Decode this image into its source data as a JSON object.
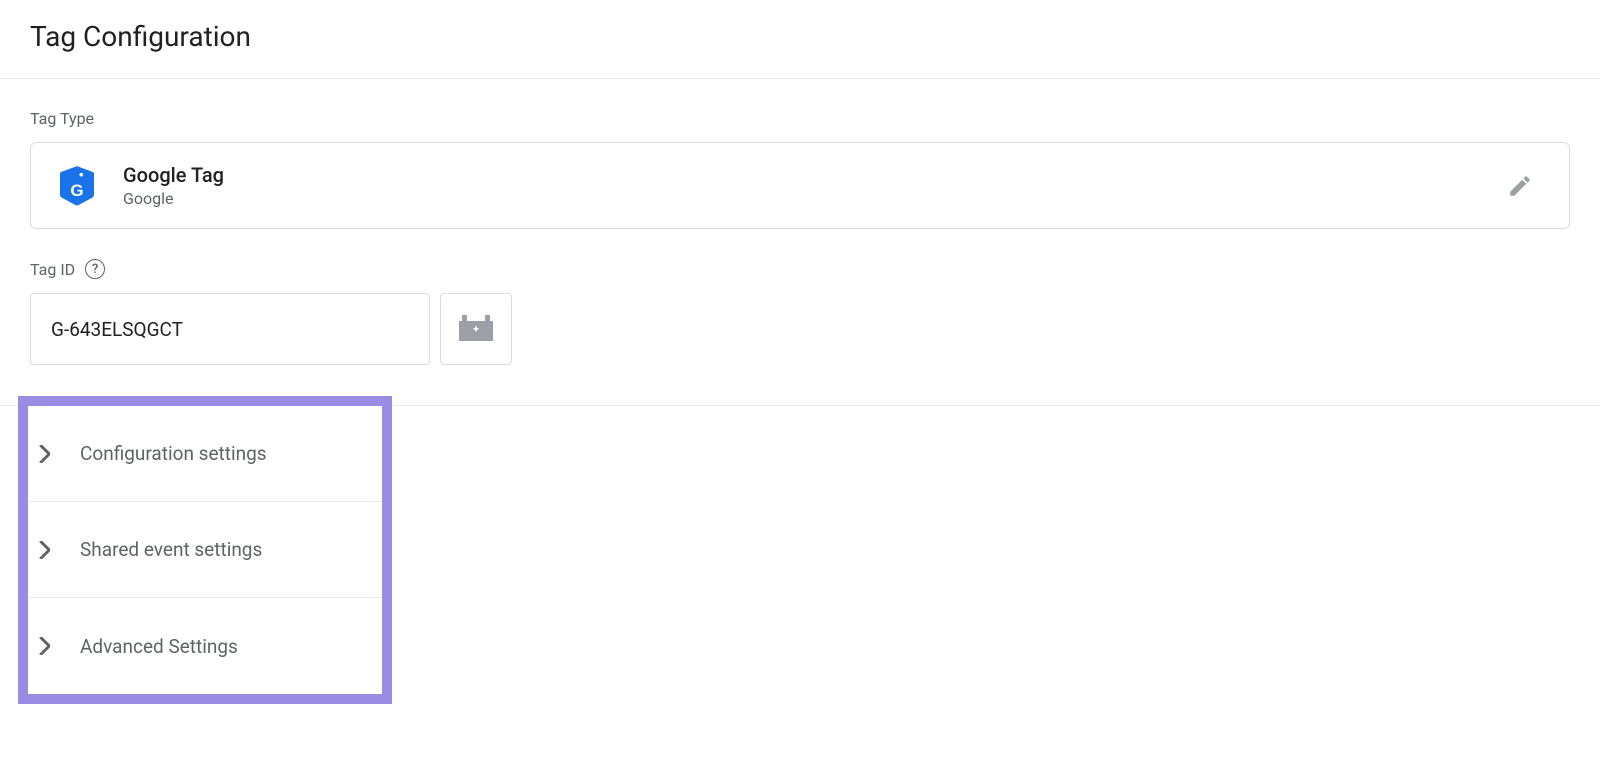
{
  "header": {
    "title": "Tag Configuration"
  },
  "tag_type": {
    "label": "Tag Type",
    "name": "Google Tag",
    "vendor": "Google"
  },
  "tag_id": {
    "label": "Tag ID",
    "value": "G-643ELSQGCT"
  },
  "expanders": [
    {
      "label": "Configuration settings"
    },
    {
      "label": "Shared event settings"
    },
    {
      "label": "Advanced Settings"
    }
  ]
}
